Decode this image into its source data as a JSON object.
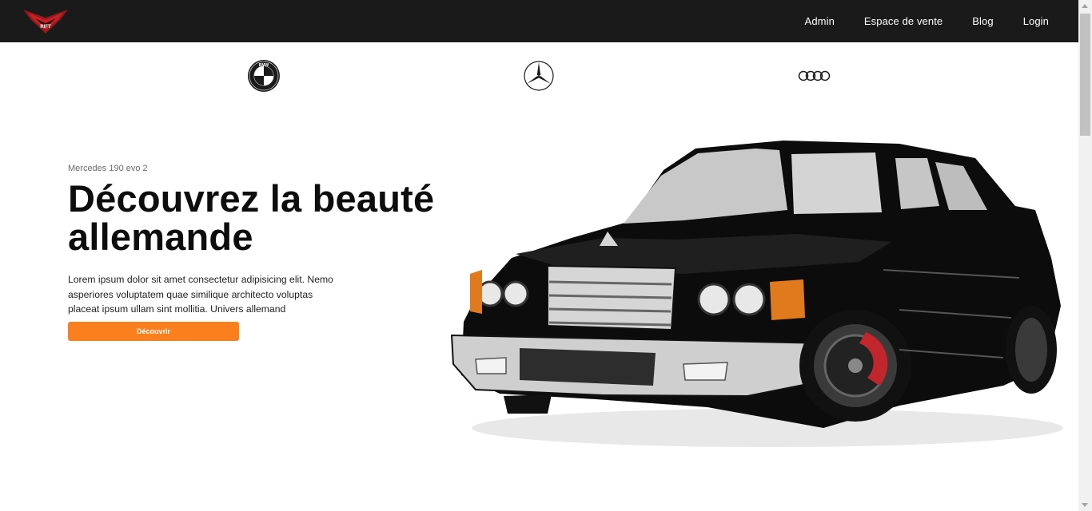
{
  "header": {
    "logo_text": "RIFT",
    "nav": [
      "Admin",
      "Espace de vente",
      "Blog",
      "Login"
    ]
  },
  "brands": {
    "bmw_text": "BMW",
    "icons": [
      "bmw-logo",
      "mercedes-logo",
      "audi-logo"
    ]
  },
  "hero": {
    "subtitle": "Mercedes 190 evo 2",
    "title_line1": "Découvrez la beauté",
    "title_line2": "allemande",
    "description": "Lorem ipsum dolor sit amet consectetur adipisicing elit. Nemo asperiores voluptatem quae similique architecto voluptas placeat ipsum ullam sint mollitia. Univers allemand",
    "button_label": "Découvrir"
  },
  "colors": {
    "navbar": "#1b1a1a",
    "accent": "#fc7f1d"
  }
}
